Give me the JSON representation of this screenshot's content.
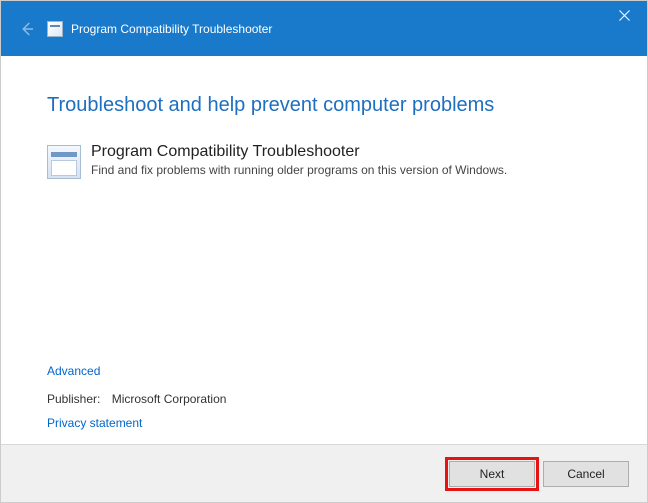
{
  "titlebar": {
    "title": "Program Compatibility Troubleshooter"
  },
  "heading": "Troubleshoot and help prevent computer problems",
  "troubleshooter": {
    "name": "Program Compatibility Troubleshooter",
    "description": "Find and fix problems with running older programs on this version of Windows."
  },
  "links": {
    "advanced": "Advanced",
    "privacy": "Privacy statement"
  },
  "publisher": {
    "label": "Publisher:",
    "value": "Microsoft Corporation"
  },
  "buttons": {
    "next": "Next",
    "cancel": "Cancel"
  }
}
